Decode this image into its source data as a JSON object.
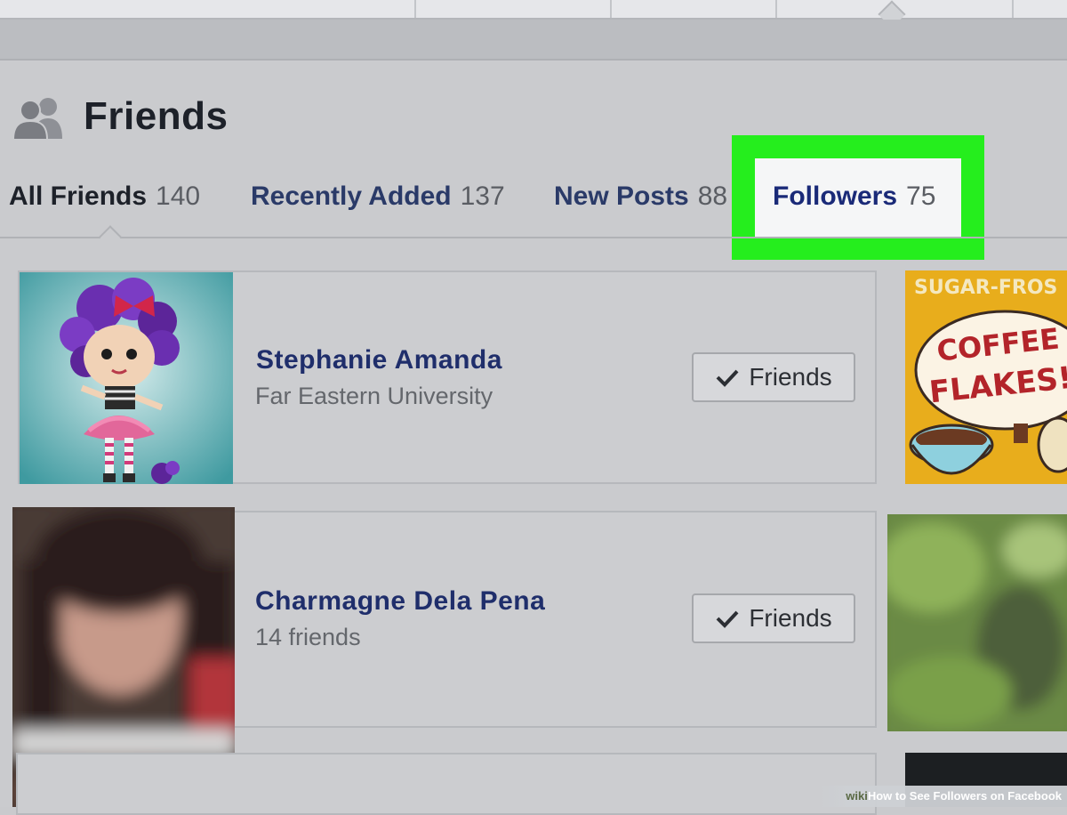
{
  "page": {
    "title": "Friends",
    "tabs": [
      {
        "label": "All Friends",
        "count": "140",
        "active": true
      },
      {
        "label": "Recently Added",
        "count": "137"
      },
      {
        "label": "New Posts",
        "count": "88"
      },
      {
        "label": "Followers",
        "count": "75",
        "highlighted": true
      }
    ]
  },
  "friends": [
    {
      "name": "Stephanie Amanda",
      "subtitle": "Far Eastern University",
      "button_label": "Friends",
      "photo": "doll-avatar"
    },
    {
      "name": "Charmagne Dela Pena",
      "subtitle": "14 friends",
      "button_label": "Friends",
      "photo": "blurred-avatar"
    }
  ],
  "side_thumbs": [
    {
      "photo": "coffee-flakes-poster",
      "text_top": "SUGAR-FROS",
      "text_main_1": "COFFEE",
      "text_main_2": "FLAKES!"
    },
    {
      "photo": "blurred-green-photo"
    },
    {
      "photo": "dark-photo"
    }
  ],
  "watermark": {
    "brand": "wiki",
    "text": "How to See Followers on Facebook"
  },
  "colors": {
    "highlight": "#25ee1d",
    "link": "#1f2e6b",
    "panel": "#cacbce"
  }
}
